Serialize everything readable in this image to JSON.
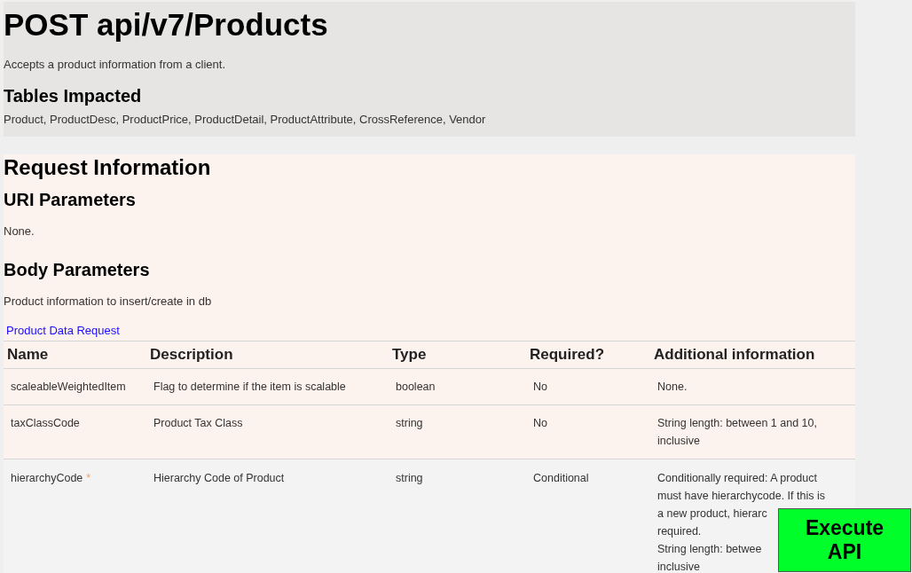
{
  "header": {
    "title": "POST api/v7/Products",
    "description": "Accepts a product information from a client.",
    "tables_heading": "Tables Impacted",
    "tables": "Product, ProductDesc, ProductPrice, ProductDetail, ProductAttribute, CrossReference, Vendor"
  },
  "request": {
    "heading": "Request Information",
    "uri_heading": "URI Parameters",
    "uri_text": "None.",
    "body_heading": "Body Parameters",
    "body_text": "Product information to insert/create in db",
    "link": "Product Data Request",
    "table": {
      "columns": [
        "Name",
        "Description",
        "Type",
        "Required?",
        "Additional information"
      ],
      "rows": [
        {
          "name": "scaleableWeightedItem",
          "description": "Flag to determine if the item is scalable",
          "type": "boolean",
          "required": "No",
          "info": [
            "None."
          ]
        },
        {
          "name": "taxClassCode",
          "description": "Product Tax Class",
          "type": "string",
          "required": "No",
          "info": [
            "String length: between 1 and 10,",
            "inclusive"
          ]
        },
        {
          "name": "hierarchyCode",
          "marker": "*",
          "description": "Hierarchy Code of Product",
          "type": "string",
          "required": "Conditional",
          "info": [
            "Conditionally required: A product",
            "must have hierarchycode. If this is",
            "a new product, hierarc",
            "required.",
            "String length: betwee",
            "inclusive"
          ]
        }
      ]
    }
  },
  "execute_button": "Execute\nAPI"
}
